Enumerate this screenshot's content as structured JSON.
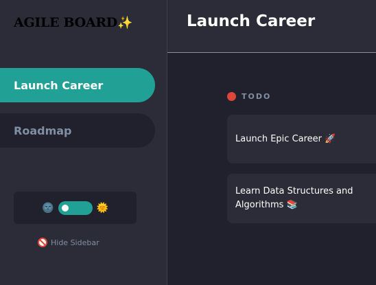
{
  "sidebar": {
    "logo": "AGILE BOARD",
    "logo_sparkle": "✨",
    "boards": [
      {
        "label": "Launch Career",
        "active": true
      },
      {
        "label": "Roadmap",
        "active": false
      }
    ],
    "theme": {
      "dark_icon": "🌚",
      "light_icon": "🌞",
      "dark_mode_on": true
    },
    "hide_label": "Hide Sidebar"
  },
  "header": {
    "title": "Launch Career"
  },
  "columns": [
    {
      "name": "TODO",
      "color": "#e0453a",
      "tasks": [
        {
          "title": "Launch Epic Career 🚀"
        },
        {
          "title": "Learn Data Structures and Algorithms 📚"
        }
      ]
    }
  ],
  "colors": {
    "accent": "#21a195",
    "sidebar_bg": "#2b2c37",
    "main_bg": "#21212d",
    "muted_text": "#828fa3"
  }
}
